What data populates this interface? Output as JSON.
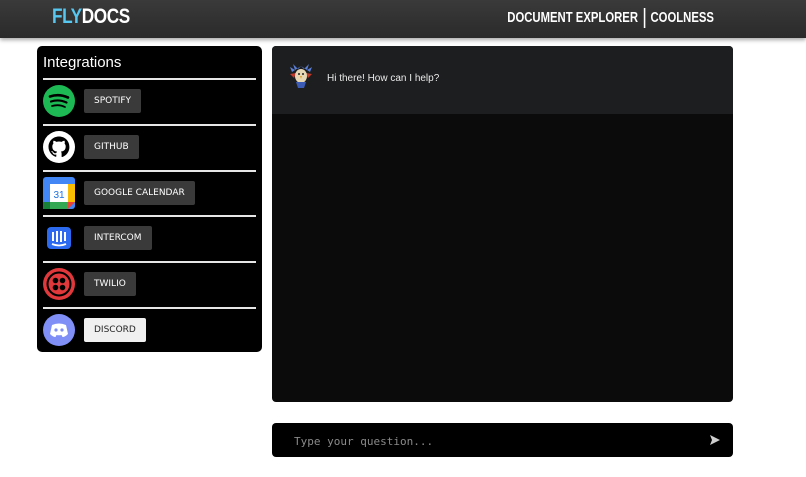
{
  "header": {
    "logo_fly": "FLY",
    "logo_docs": "DOCS",
    "nav": [
      "DOCUMENT EXPLORER",
      "COOLNESS"
    ]
  },
  "integrations": {
    "title": "Integrations",
    "items": [
      {
        "label": "SPOTIFY",
        "icon": "spotify-icon"
      },
      {
        "label": "GITHUB",
        "icon": "github-icon"
      },
      {
        "label": "GOOGLE CALENDAR",
        "icon": "google-calendar-icon",
        "calendar_day": "31"
      },
      {
        "label": "INTERCOM",
        "icon": "intercom-icon"
      },
      {
        "label": "TWILIO",
        "icon": "twilio-icon"
      },
      {
        "label": "DISCORD",
        "icon": "discord-icon"
      }
    ]
  },
  "chat": {
    "greeting": "Hi there! How can I help?",
    "avatar": "eagle-avatar-icon"
  },
  "input": {
    "placeholder": "Type your question...",
    "value": ""
  },
  "colors": {
    "brand_blue": "#56c7f0",
    "spotify": "#1db954",
    "twilio": "#e0383b",
    "intercom": "#2c6bf0",
    "discord": "#7f8ff5"
  }
}
